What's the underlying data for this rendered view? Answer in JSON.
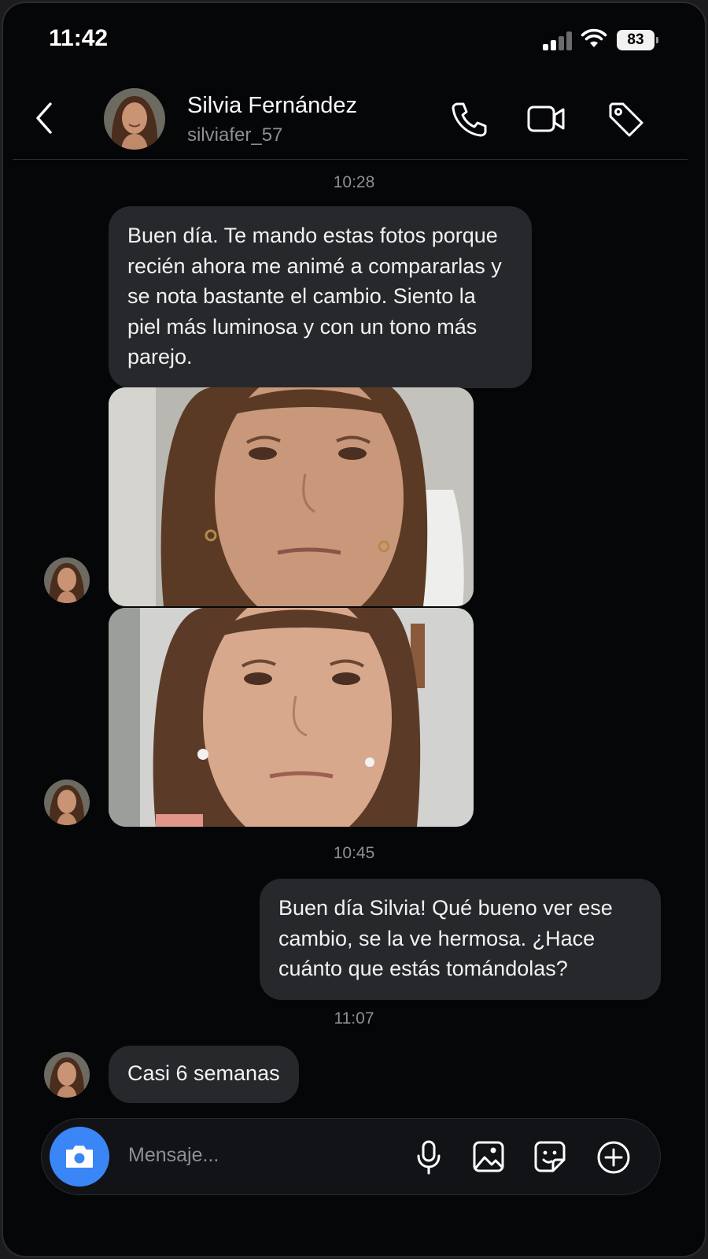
{
  "status_bar": {
    "time": "11:42",
    "battery": "83"
  },
  "header": {
    "name": "Silvia Fernández",
    "handle": "silviafer_57"
  },
  "messages": [
    {
      "type": "timestamp",
      "text": "10:28"
    },
    {
      "type": "incoming_text",
      "text": "Buen día. Te mando estas fotos porque recién ahora me animé a compararlas y se nota bastante el cambio. Siento la piel más luminosa y con un tono más parejo."
    },
    {
      "type": "timestamp",
      "text": "10:45"
    },
    {
      "type": "outgoing_text",
      "text": "Buen día Silvia! Qué bueno ver ese cambio, se la ve hermosa. ¿Hace cuánto que estás tomándolas?"
    },
    {
      "type": "timestamp",
      "text": "11:07"
    },
    {
      "type": "incoming_text",
      "text": "Casi 6 semanas"
    }
  ],
  "composer": {
    "placeholder": "Mensaje..."
  },
  "colors": {
    "background": "#050608",
    "bubble": "#26282c",
    "accent": "#3a86f7",
    "secondary_text": "#8e8e93"
  }
}
